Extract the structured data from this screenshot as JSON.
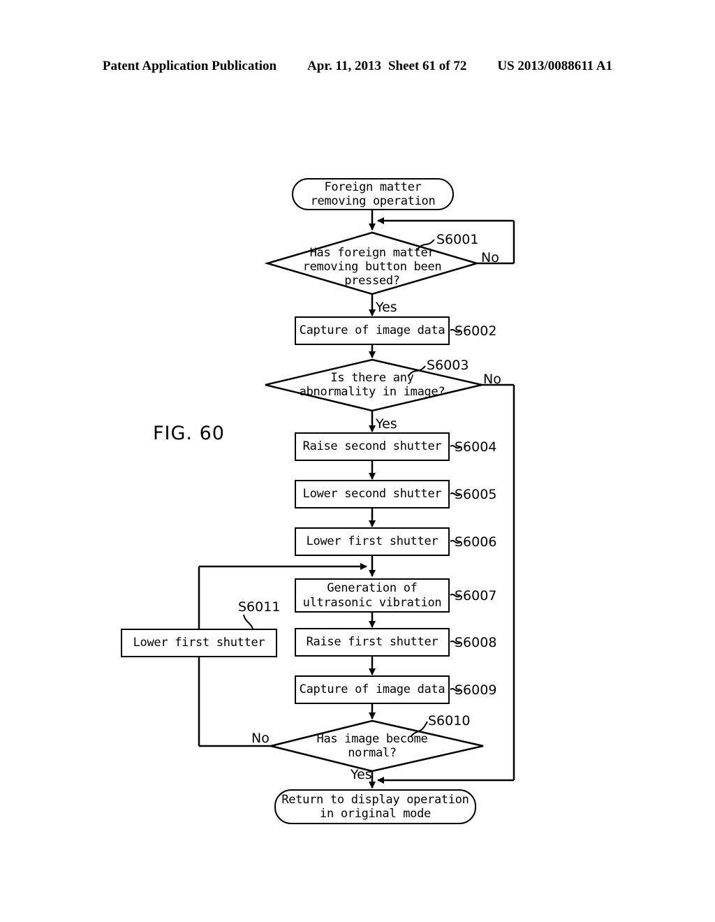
{
  "header": {
    "publication": "Patent Application Publication",
    "date": "Apr. 11, 2013",
    "sheet": "Sheet 61 of 72",
    "number": "US 2013/0088611 A1"
  },
  "figure": {
    "label": "FIG. 60"
  },
  "flowchart": {
    "start": {
      "text": "Foreign matter\nremoving operation"
    },
    "end": {
      "text": "Return to display operation\nin original mode"
    },
    "nodes": [
      {
        "id": "S6001",
        "type": "decision",
        "text": "Has foreign matter\nremoving button been\npressed?",
        "step": "S6001",
        "yes": "Yes",
        "no": "No"
      },
      {
        "id": "S6002",
        "type": "process",
        "text": "Capture of image data",
        "step": "S6002"
      },
      {
        "id": "S6003",
        "type": "decision",
        "text": "Is there any\nabnormality in image?",
        "step": "S6003",
        "yes": "Yes",
        "no": "No"
      },
      {
        "id": "S6004",
        "type": "process",
        "text": "Raise second shutter",
        "step": "S6004"
      },
      {
        "id": "S6005",
        "type": "process",
        "text": "Lower second shutter",
        "step": "S6005"
      },
      {
        "id": "S6006",
        "type": "process",
        "text": "Lower first shutter",
        "step": "S6006"
      },
      {
        "id": "S6007",
        "type": "process",
        "text": "Generation of\nultrasonic vibration",
        "step": "S6007"
      },
      {
        "id": "S6008",
        "type": "process",
        "text": "Raise first shutter",
        "step": "S6008"
      },
      {
        "id": "S6009",
        "type": "process",
        "text": "Capture of image data",
        "step": "S6009"
      },
      {
        "id": "S6010",
        "type": "decision",
        "text": "Has image become\nnormal?",
        "step": "S6010",
        "yes": "Yes",
        "no": "No"
      },
      {
        "id": "S6011",
        "type": "process",
        "text": "Lower first shutter",
        "step": "S6011"
      }
    ]
  },
  "colors": {
    "ink": "#000000",
    "paper": "#ffffff"
  }
}
